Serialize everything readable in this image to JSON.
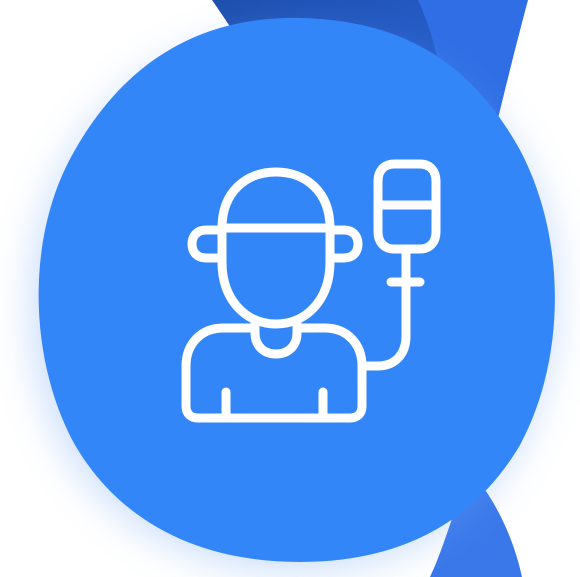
{
  "illustration": {
    "subject": "patient-with-iv-drip",
    "icon": "patient-iv-drip-icon"
  },
  "colors": {
    "background": "#ffffff",
    "ribbon_dark": "#1e4fae",
    "ribbon_mid": "#2a66d9",
    "ribbon_light": "#3f7cf0",
    "blob_fill": "#3386f8",
    "glow": "#6fa4f5",
    "icon_stroke": "#ffffff"
  }
}
